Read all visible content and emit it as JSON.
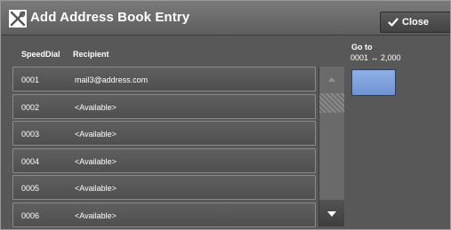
{
  "header": {
    "title": "Add Address Book Entry",
    "icon": "tools-icon",
    "close_label": "Close",
    "close_icon": "checkmark-icon"
  },
  "columns": {
    "speeddial": "SpeedDial",
    "recipient": "Recipient"
  },
  "rows": [
    {
      "speeddial": "0001",
      "recipient": "mail3@address.com"
    },
    {
      "speeddial": "0002",
      "recipient": "<Available>"
    },
    {
      "speeddial": "0003",
      "recipient": "<Available>"
    },
    {
      "speeddial": "0004",
      "recipient": "<Available>"
    },
    {
      "speeddial": "0005",
      "recipient": "<Available>"
    },
    {
      "speeddial": "0006",
      "recipient": "<Available>"
    }
  ],
  "goto": {
    "label": "Go to",
    "range": "0001 ↔ 2,000"
  },
  "colors": {
    "background": "#585858",
    "goto_button": "#7a9cdc",
    "row": "#575757"
  }
}
